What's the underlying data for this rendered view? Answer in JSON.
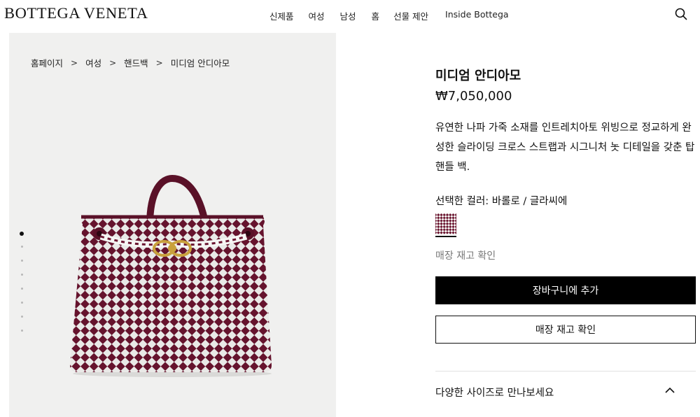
{
  "header": {
    "logo": "BOTTEGA VENETA",
    "nav": [
      "신제품",
      "여성",
      "남성",
      "홈",
      "선물 제안",
      "Inside Bottega"
    ],
    "search_icon": "search-icon"
  },
  "breadcrumb": {
    "items": [
      "홈페이지",
      "여성",
      "핸드백",
      "미디엄 안디아모"
    ],
    "separator": ">"
  },
  "gallery": {
    "image_count": 8,
    "active_index": 0,
    "colors": {
      "bag_burgundy": "#6b1530",
      "bag_white": "#f6f6f4",
      "hardware_gold": "#c9a13c",
      "background": "#f0f0ef"
    }
  },
  "product": {
    "name": "미디엄 안디아모",
    "price": "₩7,050,000",
    "description": "유연한 나파 가죽 소재를 인트레치아토 위빙으로 정교하게 완성한 슬라이딩 크로스 스트랩과 시그니처 놋 디테일을 갖춘 탑 핸들 백.",
    "color_label": "선택한 컬러: 바롤로 / 글라씨에",
    "stock_link": "매장 재고 확인",
    "add_to_cart": "장바구니에 추가",
    "stock_button": "매장 재고 확인",
    "sizes_label": "다양한 사이즈로 만나보세요",
    "chevron_icon": "chevron-up-icon"
  }
}
